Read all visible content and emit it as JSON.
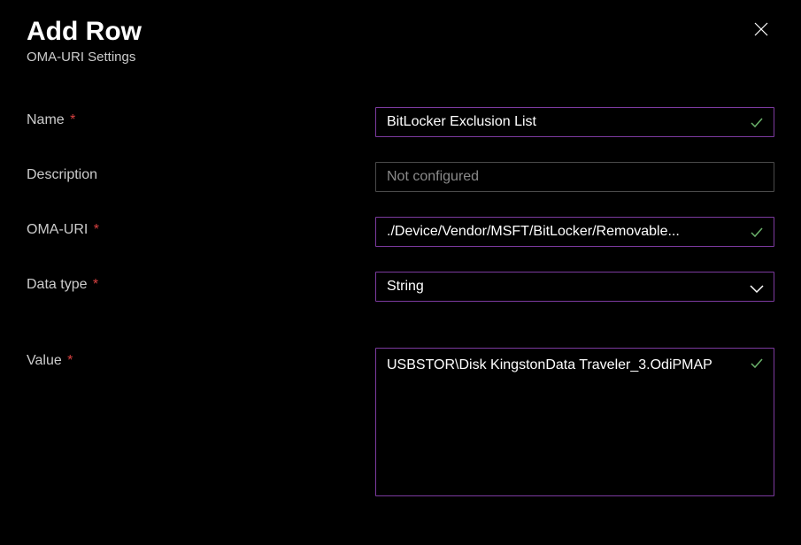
{
  "header": {
    "title": "Add Row",
    "subtitle": "OMA-URI Settings"
  },
  "form": {
    "name": {
      "label": "Name",
      "value": "BitLocker Exclusion List",
      "required": true,
      "valid": true
    },
    "description": {
      "label": "Description",
      "placeholder": "Not configured",
      "value": "",
      "required": false
    },
    "omaUri": {
      "label": "OMA-URI",
      "value": "./Device/Vendor/MSFT/BitLocker/Removable...",
      "required": true,
      "valid": true
    },
    "dataType": {
      "label": "Data type",
      "value": "String",
      "required": true
    },
    "value": {
      "label": "Value",
      "value": "USBSTOR\\Disk KingstonData Traveler_3.OdiPMAP",
      "required": true,
      "valid": true
    }
  }
}
